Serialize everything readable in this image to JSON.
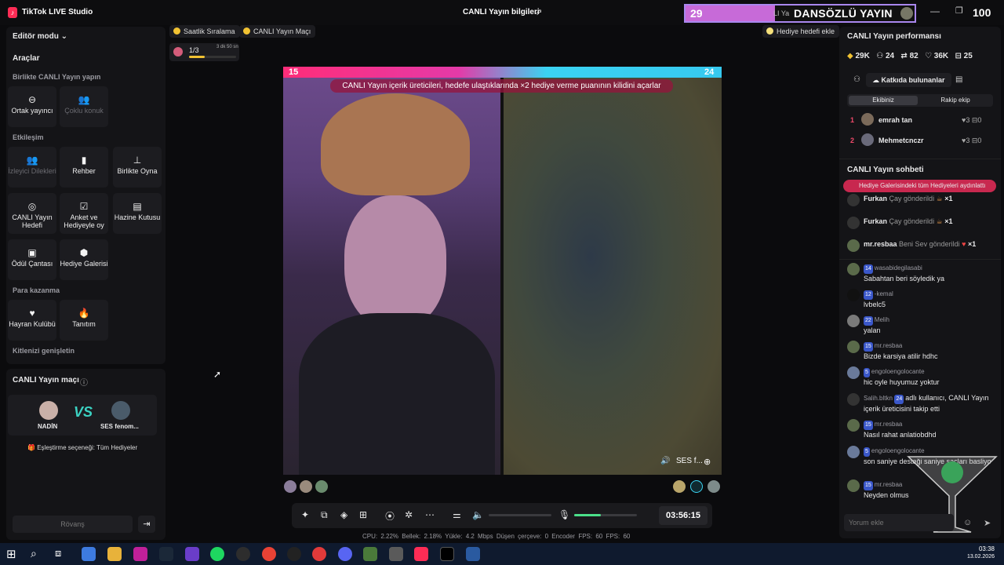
{
  "titlebar": {
    "app_title": "TikTok LIVE Studio",
    "stream_info": "CANLI Yayın bilgileri",
    "counter": "100"
  },
  "overlay": {
    "count": "29",
    "title": "DANSÖZLÜ YAYIN",
    "subtitle": "LI Ya"
  },
  "left_panel": {
    "mode": "Editör modu",
    "tools_title": "Araçlar",
    "sec_together": "Birlikte CANLI Yayın yapın",
    "cohost": "Ortak yayıncı",
    "multiguest": "Çoklu konuk",
    "sec_engage": "Etkileşim",
    "viewer_wishes": "İzleyici Dilekleri",
    "guide": "Rehber",
    "play_together": "Birlikte Oyna",
    "live_goal": "CANLI Yayın Hedefi",
    "poll": "Anket ve Hediyeyle oy",
    "treasure": "Hazine Kutusu",
    "reward_bag": "Ödül Çantası",
    "gift_gallery": "Hediye Galerisi",
    "sec_earn": "Para kazanma",
    "fan_club": "Hayran Kulübü",
    "promo": "Tanıtım",
    "sec_grow": "Kitlenizi genişletin"
  },
  "match": {
    "title": "CANLI Yayın maçı",
    "player_a": "NADİN",
    "vs": "VS",
    "player_b": "SES fenom...",
    "mode": "Eşleştirme seçeneği: Tüm Hediyeler",
    "rematch": "Rövanş"
  },
  "center": {
    "pill_hourly": "Saatlik Sıralama",
    "pill_match": "CANLI Yayın Maçı",
    "pill_goal": "Hediye hedefi ekle",
    "progress_label": "1/3",
    "progress_time": "3 dk 50 sn",
    "progress_fill": 0.33,
    "score_left": "15",
    "score_right": "24",
    "banner": "CANLI Yayın içerik üreticileri, hedefe ulaştıklarında ×2 hediye verme puanının kilidini açarlar",
    "guest_label": "SES f...",
    "timer": "03:56:15",
    "stats": "CPU: 2.22%   Bellek: 2.18%   Yükle: 4.2 Mbps   Düşen çerçeve: 0   Encoder FPS: 60   FPS: 60"
  },
  "perf": {
    "title": "CANLI Yayın performansı",
    "diamonds": "29K",
    "viewers": "24",
    "shares": "82",
    "likes": "36K",
    "gifts": "25"
  },
  "ranking": {
    "contributors": "Katkıda bulunanlar",
    "tab_team": "Ekibiniz",
    "tab_rival": "Rakip ekip",
    "rows": [
      {
        "rank": "1",
        "name": "emrah tan",
        "hearts": "3",
        "gifts": "0"
      },
      {
        "rank": "2",
        "name": "Mehmetcnczr",
        "hearts": "3",
        "gifts": "0"
      }
    ]
  },
  "chat": {
    "title": "CANLI Yayın sohbeti",
    "notice": "Hediye Galerisindeki tüm Hediyeleri aydınlattı",
    "gifts": [
      {
        "user": "Furkan",
        "text": "Çay gönderildi",
        "count": "×1"
      },
      {
        "user": "Furkan",
        "text": "Çay gönderildi",
        "count": "×1"
      },
      {
        "user": "mr.resbaa",
        "text": "Beni Sev gönderildi",
        "count": "×1"
      }
    ],
    "messages": [
      {
        "lvl": "14",
        "user": "wasabidegilasabi",
        "text": "Sabahtan beri söyledik ya"
      },
      {
        "lvl": "12",
        "user": "-kemal",
        "text": "lvbelc5"
      },
      {
        "lvl": "22",
        "user": "Melih",
        "text": "yalan"
      },
      {
        "lvl": "15",
        "user": "mr.resbaa",
        "text": "Bizde karsiya atilir hdhc"
      },
      {
        "lvl": "5",
        "user": "engoloengolocante",
        "text": "hic oyle huyumuz yoktur"
      },
      {
        "lvl": "24",
        "user": "Salih.bltkn",
        "text": "adlı kullanıcı, CANLI Yayın içerik üreticisini takip etti"
      },
      {
        "lvl": "15",
        "user": "mr.resbaa",
        "text": "Nasıl rahat anlatiobdhd"
      },
      {
        "lvl": "5",
        "user": "engoloengolocante",
        "text": "son saniye desteği saniye saçları basliyo"
      },
      {
        "lvl": "15",
        "user": "mr.resbaa",
        "text": "Neyden olmus"
      }
    ],
    "placeholder": "Yorum ekle"
  },
  "taskbar": {
    "time": "03:38",
    "date": "13.02.2026"
  }
}
